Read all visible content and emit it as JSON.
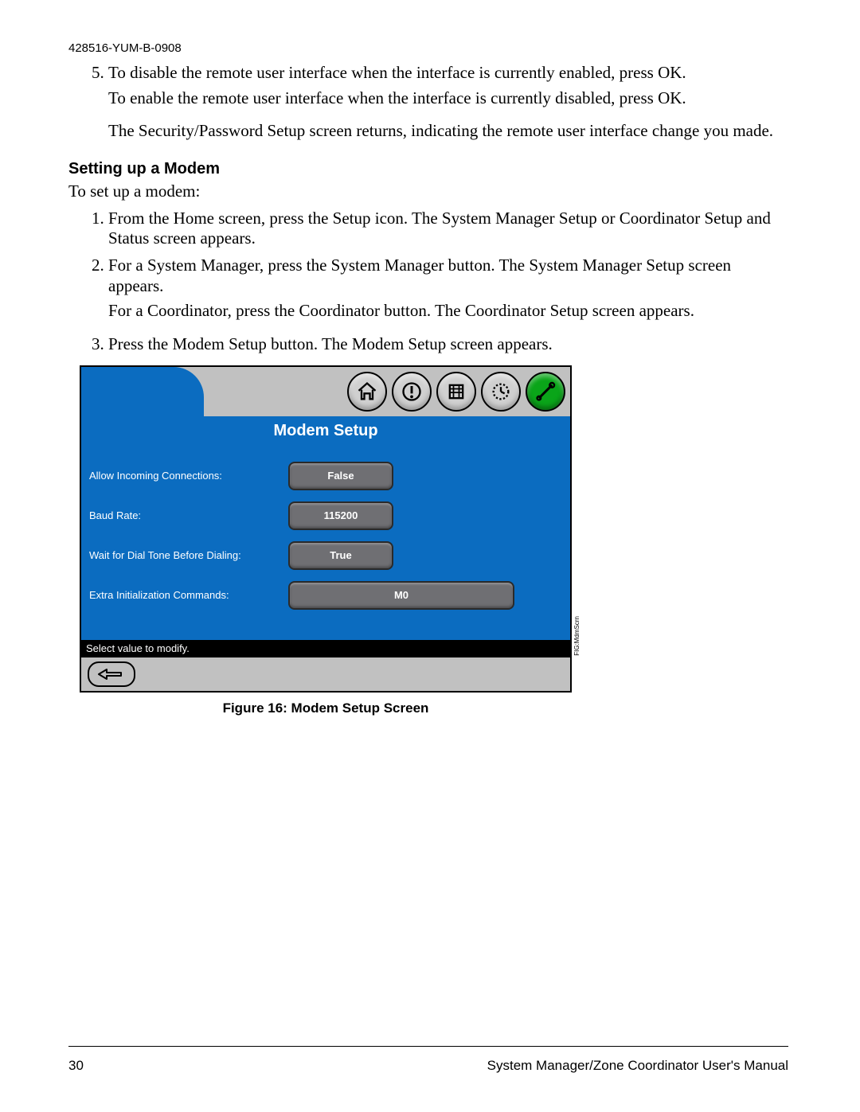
{
  "doc_id": "428516-YUM-B-0908",
  "list5": {
    "num": "5.",
    "item": "To disable the remote user interface when the interface is currently enabled, press OK.",
    "para_a": "To enable the remote user interface when the interface is currently disabled, press OK.",
    "para_b": "The Security/Password Setup screen returns, indicating the remote user interface change you made."
  },
  "section_heading": "Setting up a Modem",
  "intro": "To set up a modem:",
  "steps": {
    "s1": "From the Home screen, press the Setup icon. The System Manager Setup or Coordinator Setup and Status screen appears.",
    "s2": "For a System Manager, press the System Manager button. The System Manager Setup screen appears.",
    "s2b": "For a Coordinator, press the Coordinator button. The Coordinator Setup screen appears.",
    "s3": "Press the Modem Setup button. The Modem Setup screen appears."
  },
  "screen": {
    "title": "Modem Setup",
    "rows": [
      {
        "label": "Allow Incoming Connections:",
        "value": "False"
      },
      {
        "label": "Baud Rate:",
        "value": "115200"
      },
      {
        "label": "Wait for Dial Tone Before Dialing:",
        "value": "True"
      },
      {
        "label": "Extra Initialization Commands:",
        "value": "M0"
      }
    ],
    "status": "Select value to modify.",
    "side_label": "FIG:MdmScrn"
  },
  "caption": "Figure 16: Modem Setup Screen",
  "footer": {
    "page": "30",
    "title": "System Manager/Zone Coordinator User's Manual"
  }
}
